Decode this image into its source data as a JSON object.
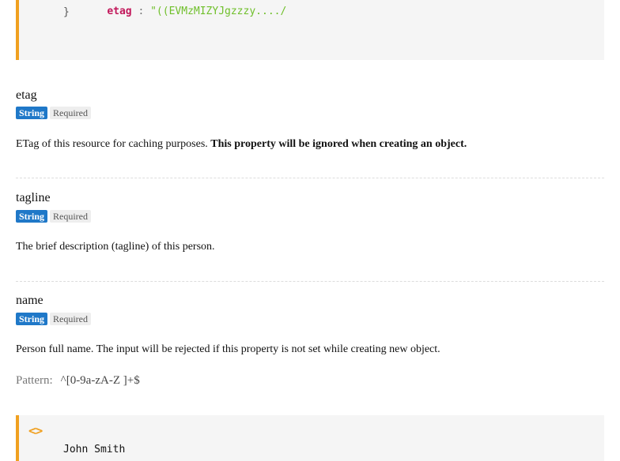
{
  "top_code": {
    "line1_key": "etag",
    "line1_sep": " : ",
    "line1_value": "\"((EVMzMIZYJgzzzy..../",
    "line2": "}"
  },
  "props": [
    {
      "name": "etag",
      "type": "String",
      "required": "Required",
      "desc_plain": "ETag of this resource for caching purposes. ",
      "desc_bold": "This property will be ignored when creating an object."
    },
    {
      "name": "tagline",
      "type": "String",
      "required": "Required",
      "desc_plain": "The brief description (tagline) of this person."
    },
    {
      "name": "name",
      "type": "String",
      "required": "Required",
      "desc_plain": "Person full name. The input will be rejected if this property is not set while creating new object.",
      "pattern_label": "Pattern:",
      "pattern_value": "^[0-9a-zA-Z ]+$"
    }
  ],
  "bottom_code": {
    "icon": "code-icon",
    "icon_glyph": "<>",
    "example": "John Smith"
  },
  "colors": {
    "accent_border": "#f0a020",
    "type_badge": "#1f78c8"
  }
}
